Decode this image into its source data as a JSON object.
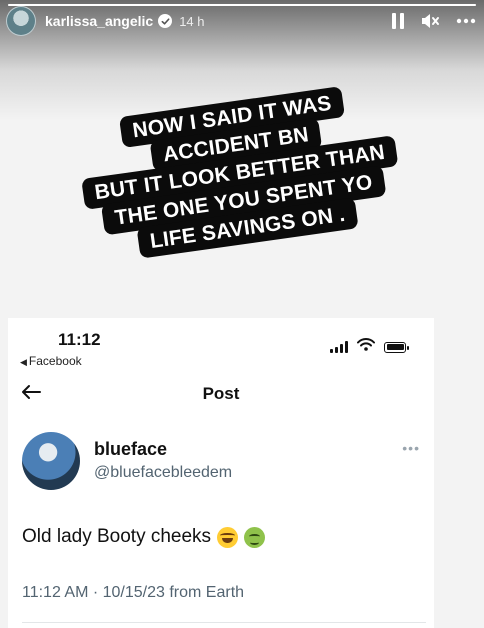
{
  "story": {
    "username": "karlissa_angelic",
    "time_ago": "14 h",
    "progress": 1.0,
    "caption_lines": [
      "NOW I SAID IT WAS",
      "ACCIDENT BN",
      "BUT IT LOOK BETTER THAN",
      "THE ONE YOU SPENT YO",
      "LIFE SAVINGS ON ."
    ]
  },
  "tweet_screenshot": {
    "status_time": "11:12",
    "back_app_label": "Facebook",
    "nav_title": "Post",
    "author_name": "blueface",
    "author_handle": "@bluefacebleedem",
    "text": "Old lady Booty cheeks",
    "emojis": [
      "face-with-tears-of-joy",
      "nauseated-face"
    ],
    "meta": "11:12 AM · 10/15/23 from Earth"
  },
  "colors": {
    "caption_bg": "#0b0b0b",
    "caption_fg": "#ffffff",
    "handle_gray": "#536471"
  }
}
